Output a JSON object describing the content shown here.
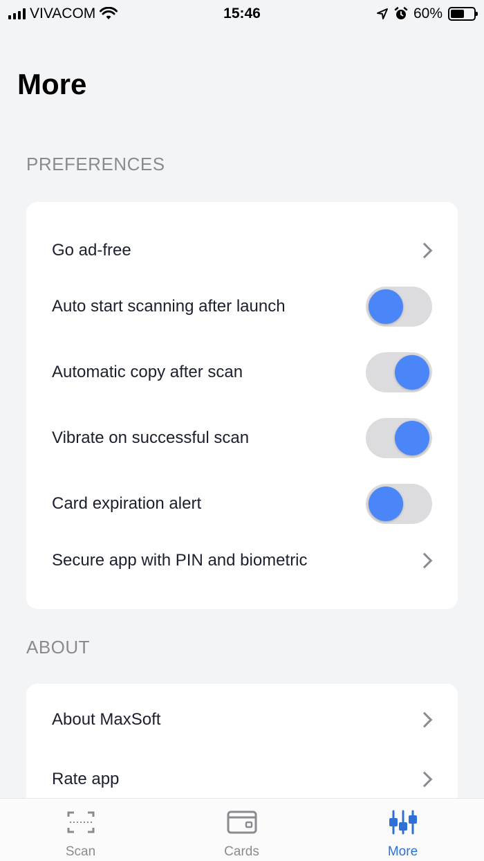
{
  "status_bar": {
    "carrier": "VIVACOM",
    "time": "15:46",
    "battery": "60%",
    "battery_level": 0.6
  },
  "page": {
    "title": "More"
  },
  "sections": {
    "preferences": {
      "label": "PREFERENCES",
      "rows": [
        {
          "label": "Go ad-free",
          "control": "chevron"
        },
        {
          "label": "Auto start scanning after launch",
          "control": "toggle",
          "on": false
        },
        {
          "label": "Automatic copy after scan",
          "control": "toggle",
          "on": true
        },
        {
          "label": "Vibrate on successful scan",
          "control": "toggle",
          "on": true
        },
        {
          "label": "Card expiration alert",
          "control": "toggle",
          "on": false
        },
        {
          "label": "Secure app with PIN and biometric",
          "control": "chevron"
        }
      ]
    },
    "about": {
      "label": "ABOUT",
      "rows": [
        {
          "label": "About MaxSoft",
          "control": "chevron"
        },
        {
          "label": "Rate app",
          "control": "chevron"
        }
      ]
    }
  },
  "tab_bar": {
    "tabs": [
      {
        "label": "Scan",
        "icon": "scan-frame-icon",
        "active": false
      },
      {
        "label": "Cards",
        "icon": "wallet-icon",
        "active": false
      },
      {
        "label": "More",
        "icon": "sliders-icon",
        "active": true
      }
    ]
  },
  "colors": {
    "accent": "#4a86f7",
    "active_tab": "#2f6fd8",
    "background": "#f3f4f6"
  }
}
